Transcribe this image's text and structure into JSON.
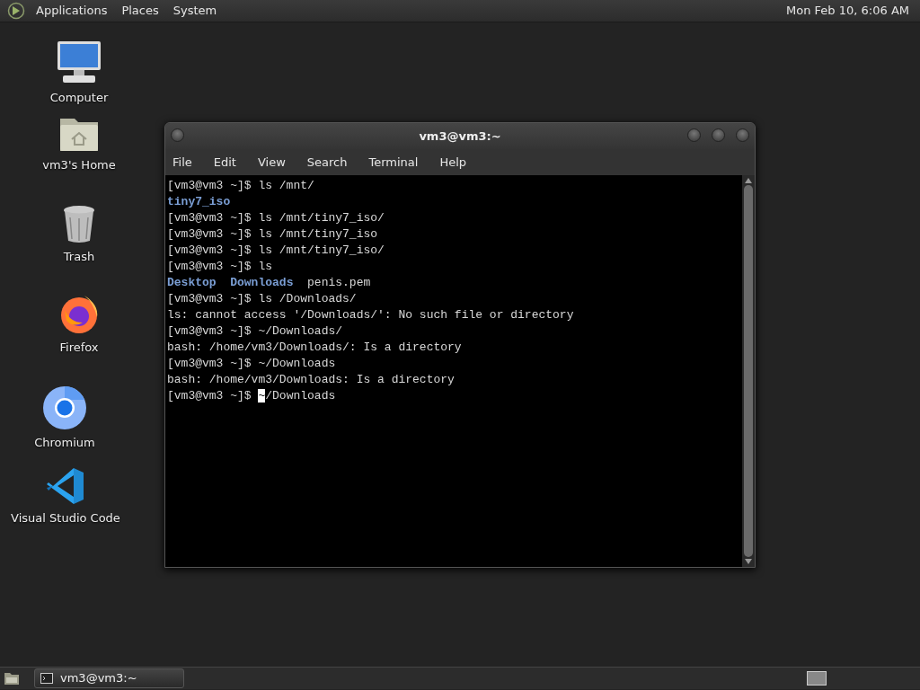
{
  "top_panel": {
    "menus": [
      "Applications",
      "Places",
      "System"
    ],
    "clock": "Mon Feb 10, 6:06 AM"
  },
  "desktop_icons": [
    {
      "kind": "computer",
      "label": "Computer"
    },
    {
      "kind": "home",
      "label": "vm3's Home"
    },
    {
      "kind": "trash",
      "label": "Trash"
    },
    {
      "kind": "firefox",
      "label": "Firefox"
    },
    {
      "kind": "chromium",
      "label": "Chromium"
    },
    {
      "kind": "vscode",
      "label": "Visual Studio Code"
    }
  ],
  "terminal_window": {
    "title": "vm3@vm3:~",
    "menus": [
      "File",
      "Edit",
      "View",
      "Search",
      "Terminal",
      "Help"
    ],
    "lines": [
      [
        {
          "kind": "text",
          "text": "[vm3@vm3 ~]$ ls /mnt/"
        }
      ],
      [
        {
          "kind": "dir",
          "text": "tiny7_iso"
        }
      ],
      [
        {
          "kind": "text",
          "text": "[vm3@vm3 ~]$ ls /mnt/tiny7_iso/"
        }
      ],
      [
        {
          "kind": "text",
          "text": "[vm3@vm3 ~]$ ls /mnt/tiny7_iso"
        }
      ],
      [
        {
          "kind": "text",
          "text": "[vm3@vm3 ~]$ ls /mnt/tiny7_iso/"
        }
      ],
      [
        {
          "kind": "text",
          "text": "[vm3@vm3 ~]$ ls"
        }
      ],
      [
        {
          "kind": "dir",
          "text": "Desktop  "
        },
        {
          "kind": "dir",
          "text": "Downloads"
        },
        {
          "kind": "text",
          "text": "  penis.pem"
        }
      ],
      [
        {
          "kind": "text",
          "text": "[vm3@vm3 ~]$ ls /Downloads/"
        }
      ],
      [
        {
          "kind": "text",
          "text": "ls: cannot access '/Downloads/': No such file or directory"
        }
      ],
      [
        {
          "kind": "text",
          "text": "[vm3@vm3 ~]$ ~/Downloads/"
        }
      ],
      [
        {
          "kind": "text",
          "text": "bash: /home/vm3/Downloads/: Is a directory"
        }
      ],
      [
        {
          "kind": "text",
          "text": "[vm3@vm3 ~]$ ~/Downloads"
        }
      ],
      [
        {
          "kind": "text",
          "text": "bash: /home/vm3/Downloads: Is a directory"
        }
      ],
      [
        {
          "kind": "text",
          "text": "[vm3@vm3 ~]$ "
        },
        {
          "kind": "cursor",
          "text": "~"
        },
        {
          "kind": "text",
          "text": "/Downloads"
        }
      ]
    ]
  },
  "taskbar": {
    "tasks": [
      {
        "label": "vm3@vm3:~",
        "selected": false
      }
    ]
  }
}
